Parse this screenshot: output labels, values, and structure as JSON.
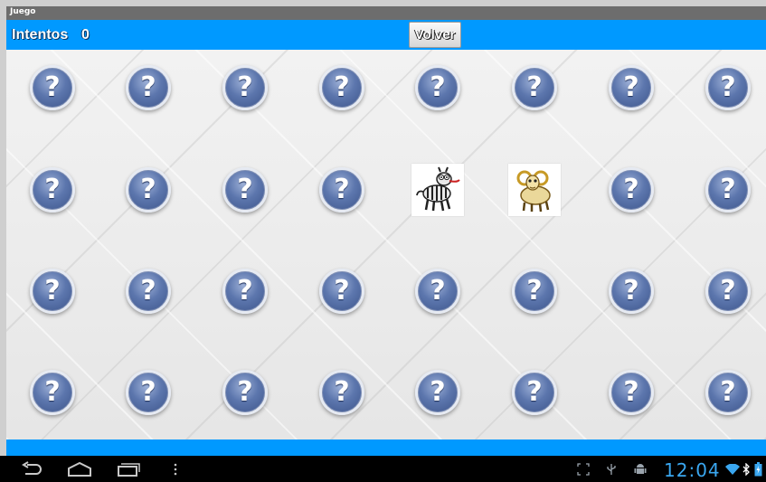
{
  "window": {
    "title": "Juego"
  },
  "header": {
    "tries_label": "Intentos",
    "tries_count": "0",
    "back_button": "Volver"
  },
  "board": {
    "hidden_symbol": "?",
    "rows": 4,
    "cols": 8,
    "revealed": [
      {
        "row": 1,
        "col": 4,
        "animal": "zebra"
      },
      {
        "row": 1,
        "col": 5,
        "animal": "ram"
      }
    ]
  },
  "status_bar": {
    "time": "12:04"
  },
  "colors": {
    "accent": "#0099ff",
    "card": "#5c76ad",
    "clock": "#3aa7f0"
  },
  "icons": [
    "back-icon",
    "home-icon",
    "recent-apps-icon",
    "menu-icon",
    "screenshot-icon",
    "usb-icon",
    "android-debug-icon",
    "wifi-icon",
    "bluetooth-icon",
    "battery-icon"
  ]
}
